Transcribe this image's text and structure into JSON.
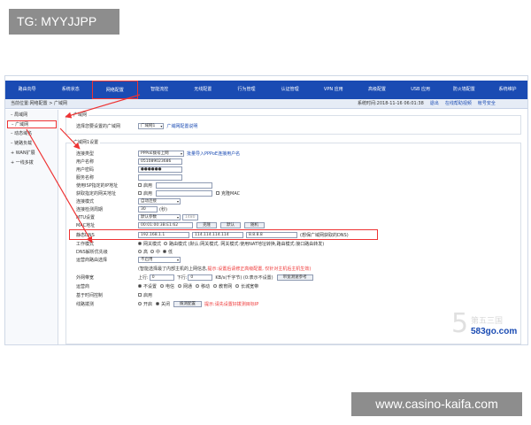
{
  "tag_label": "TG: MYYJJPP",
  "site_label": "www.casino-kaifa.com",
  "colors": {
    "nav": "#1a4bb3",
    "highlight": "#ee3333"
  },
  "nav": [
    "路由向导",
    "系统状态",
    "网络配置",
    "智能流控",
    "无线配置",
    "行为管理",
    "认证管理",
    "VPN 应用",
    "高级配置",
    "USB 应用",
    "防火墙配置",
    "系统维护"
  ],
  "infobar": {
    "location": "当前位置:网络配置 > 广域网",
    "time": "系统时间:2018-11-16 06:01:38",
    "logout": "退出",
    "help": "在线帮助视频",
    "account": "帐号安全"
  },
  "sidebar": [
    "局域网",
    "广域网",
    "动态域名",
    "链路负载",
    "WAN扩展",
    "一线多拨"
  ],
  "wan_select": {
    "legend": "广域网",
    "label": "选择您要设置的广域网",
    "value": "广域网1",
    "link": "广域网配置说明"
  },
  "wan1": {
    "legend": "广域网1设置",
    "conn_type": {
      "label": "连接类型",
      "value": "PPPoE拨号上网",
      "link": "批量导入PPPoE连接用户名"
    },
    "username": {
      "label": "用户名称",
      "value": "051089023686"
    },
    "password": {
      "label": "用户密码",
      "value": "●●●●●●"
    },
    "service": {
      "label": "服务名称",
      "value": ""
    },
    "isp_ip": {
      "label": "使用ISP指定的IP地址",
      "check": "启用"
    },
    "gw_ip": {
      "label": "获取指定的网关地址",
      "check": "启用",
      "extra": "克隆MAC"
    },
    "conn_mode": {
      "label": "连接模式",
      "value": "自动连接"
    },
    "interval": {
      "label": "连接检测周期",
      "value": "30",
      "unit": "(秒)"
    },
    "mtu": {
      "label": "MTU设置",
      "value": "默认参数",
      "num": "1480"
    },
    "mac": {
      "label": "MAC地址",
      "value": "00:01:00:3B:E1:62",
      "btn1": "克隆",
      "btn2": "默认",
      "btn3": "随机"
    },
    "dns": {
      "label": "静态DNS",
      "dns1": "192.168.1.1",
      "dns2": "114.114.114.114",
      "dns3": "8.8.8.8",
      "note": "(想保广域网获取的DNS)"
    },
    "work_mode": {
      "label": "工作模式",
      "opt1": "网关模式",
      "opt2": "路由模式 (默认:网关模式, 网关模式:使用NAT地址转换,路由模式:接口路由转发)"
    },
    "dns_pri": {
      "label": "DNS解析优先级",
      "opt1": "高",
      "opt2": "中",
      "opt3": "低"
    },
    "isp_route": {
      "label": "运营商路由选择",
      "value": "不启用"
    },
    "isp_note": {
      "text": "(智能选择最了内部主机的上网信息,",
      "red": "提示:设置后请修正高级配置, 仅针对主机后主机生效)"
    },
    "bandwidth": {
      "label": "外网带宽",
      "up": "上行:",
      "up_val": "0",
      "down": "下行:",
      "down_val": "0",
      "unit": "KB/s(千字节) (0:表示不设置)",
      "btn": "带宽测速参考"
    },
    "operator": {
      "label": "运营商",
      "opt1": "不设置",
      "opt2": "电信",
      "opt3": "网通",
      "opt4": "移动",
      "opt5": "教育网",
      "opt6": "长城宽带"
    },
    "timed": {
      "label": "基于时间控制",
      "check": "启用"
    },
    "autodial": {
      "label": "线路拨测",
      "opt1": "开启",
      "opt2": "关闭",
      "btn": "拨测配置",
      "red": "提示:请先设置好拨测目标IP"
    }
  },
  "watermark": {
    "num": "5",
    "cn": "第五三国",
    "url": "583go.com"
  }
}
